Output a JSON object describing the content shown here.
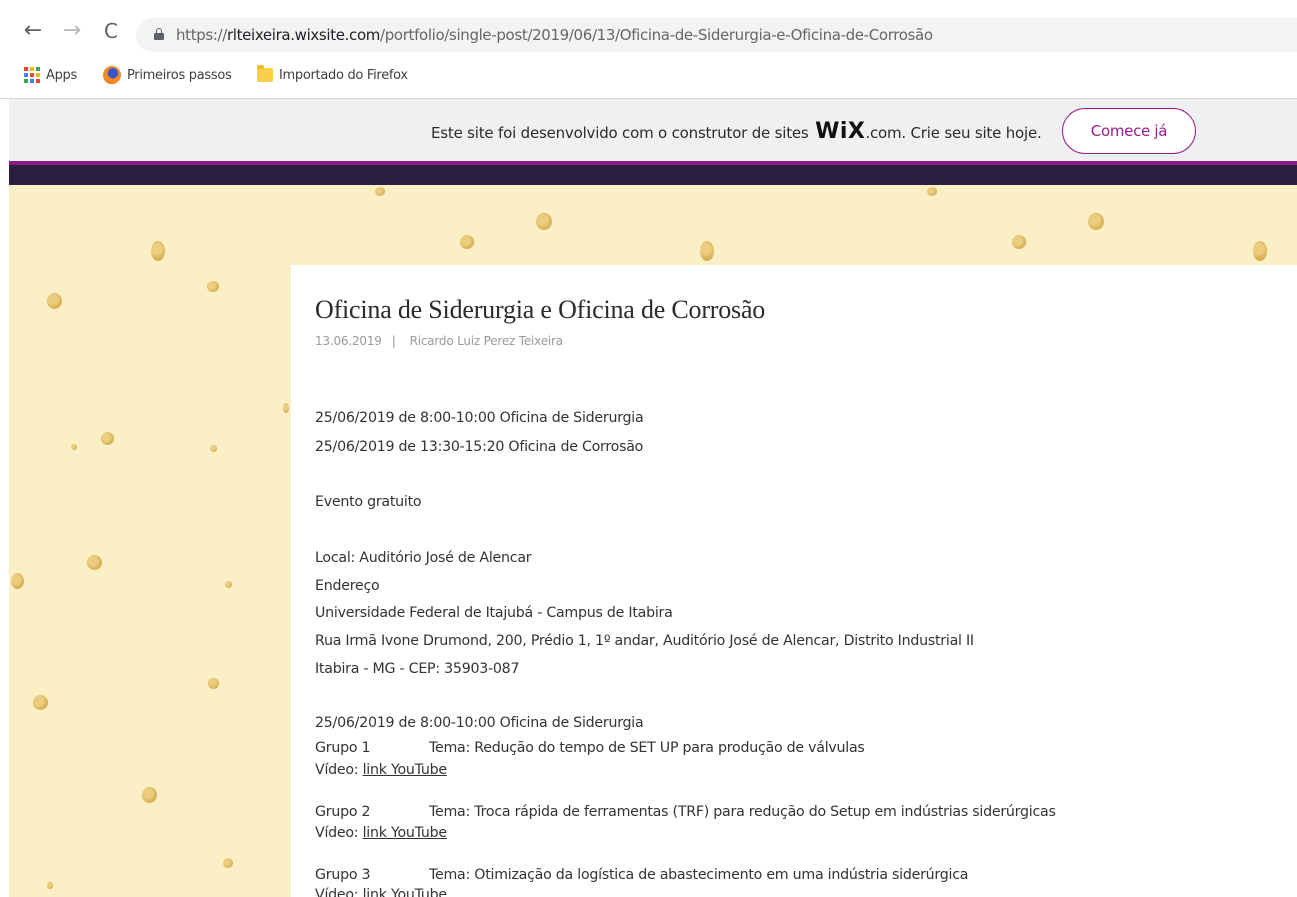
{
  "browser": {
    "url_scheme": "https://",
    "url_host": "rlteixeira.wixsite.com",
    "url_path": "/portfolio/single-post/2019/06/13/Oficina-de-Siderurgia-e-Oficina-de-Corrosão",
    "nav_icons": {
      "back": "←",
      "forward": "→",
      "reload": "C"
    },
    "bookmarks": [
      {
        "label": "Apps",
        "icon": "apps-grid-icon"
      },
      {
        "label": "Primeiros passos",
        "icon": "firefox-icon"
      },
      {
        "label": "Importado do Firefox",
        "icon": "folder-icon"
      }
    ]
  },
  "wix_banner": {
    "text_before": "Este site foi desenvolvido com o construtor de sites ",
    "logo": "WiX",
    "text_after": ".com. Crie seu site hoje.",
    "cta": "Comece já",
    "accent": "#9b1a8f"
  },
  "post": {
    "title": "Oficina de Siderurgia e Oficina de Corrosão",
    "date": "13.06.2019",
    "separator": "|",
    "author": "Ricardo Luiz Perez Teixeira",
    "lines": {
      "schedule_1": "25/06/2019 de 8:00-10:00 Oficina de Siderurgia",
      "schedule_2": "25/06/2019 de 13:30-15:20 Oficina de Corrosão",
      "free": "Evento gratuito",
      "local": "Local: Auditório José de Alencar",
      "endereco": "Endereço",
      "univ": "Universidade Federal de Itajubá - Campus de Itabira",
      "rua": "Rua Irmã Ivone Drumond, 200, Prédio 1, 1º andar, Auditório José de Alencar, Distrito Industrial II",
      "cidade": "Itabira - MG - CEP: 35903-087",
      "section": "25/06/2019 de 8:00-10:00 Oficina de Siderurgia"
    },
    "groups": [
      {
        "group": "Grupo 1",
        "tema": "Tema: Redução do tempo de SET UP para produção de válvulas",
        "video_label": "Vídeo: ",
        "video_link": "link YouTube"
      },
      {
        "group": "Grupo 2",
        "tema": "Tema: Troca rápida de ferramentas (TRF) para redução do Setup em indústrias siderúrgicas",
        "video_label": "Vídeo: ",
        "video_link": "link YouTube"
      },
      {
        "group": "Grupo 3",
        "tema": "Tema: Otimização da logística de abastecimento em uma indústria siderúrgica",
        "video_label": "Vídeo: ",
        "video_link": "link YouTube"
      }
    ]
  }
}
